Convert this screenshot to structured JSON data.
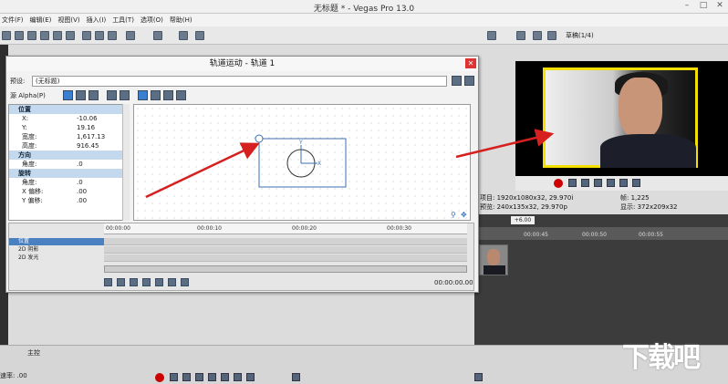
{
  "app": {
    "title": "无标题 * - Vegas Pro 13.0"
  },
  "menu": {
    "items": [
      "文件(F)",
      "编辑(E)",
      "视图(V)",
      "插入(I)",
      "工具(T)",
      "选项(O)",
      "帮助(H)"
    ]
  },
  "dialog": {
    "title": "轨道运动 - 轨道 1",
    "preset_label": "预设:",
    "preset_value": "(无标题)",
    "source_label": "源 Alpha(P)",
    "sections": [
      {
        "name": "位置",
        "rows": [
          {
            "k": "X:",
            "v": "-10.06"
          },
          {
            "k": "Y:",
            "v": "19.16"
          },
          {
            "k": "宽度:",
            "v": "1,617.13"
          },
          {
            "k": "高度:",
            "v": "916.45"
          }
        ]
      },
      {
        "name": "方向",
        "rows": [
          {
            "k": "角度:",
            "v": ".0"
          }
        ]
      },
      {
        "name": "旋转",
        "rows": [
          {
            "k": "角度:",
            "v": ".0"
          },
          {
            "k": "X 偏移:",
            "v": ".00"
          },
          {
            "k": "Y 偏移:",
            "v": ".00"
          }
        ]
      }
    ],
    "timeline": {
      "ticks": [
        "00:00:00",
        "00:00:10",
        "00:00:20",
        "00:00:30"
      ],
      "tracks": [
        "位置",
        "2D 阴影",
        "2D 发光"
      ],
      "timecode": "00:00:00.00"
    }
  },
  "preview": {
    "mode": "草稿(1/4)",
    "project": "项目: 1920x1080x32, 29.970i",
    "preview_res": "预览: 240x135x32, 29.970p",
    "frame": "帧: 1,225",
    "display": "显示: 372x209x32"
  },
  "main_timeline": {
    "ticks": [
      "00:00:45",
      "00:00:50",
      "00:00:55"
    ],
    "cursor": "+6.00"
  },
  "bottom": {
    "master": "主控",
    "rate": "速率: .00"
  },
  "watermark": "下载吧"
}
